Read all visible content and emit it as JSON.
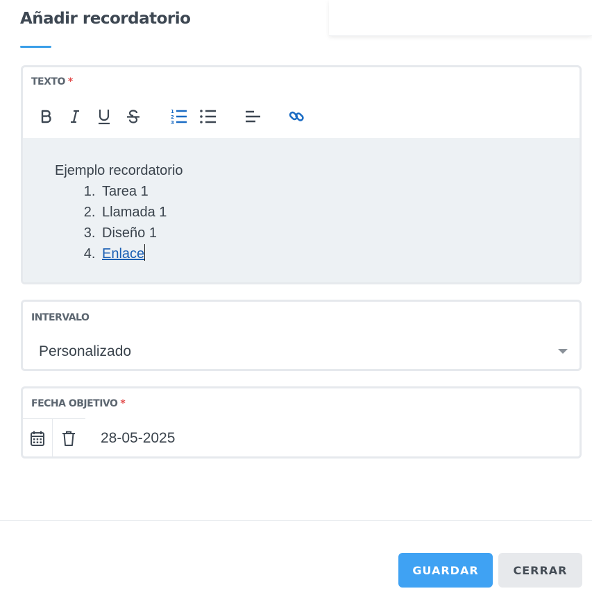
{
  "dialog": {
    "title": "Añadir recordatorio"
  },
  "texto_field": {
    "label": "TEXTO",
    "required_mark": "*",
    "toolbar": {
      "bold": "bold-icon",
      "italic": "italic-icon",
      "underline": "underline-icon",
      "strikethrough": "strikethrough-icon",
      "ordered_list": "ordered-list-icon",
      "bullet_list": "bullet-list-icon",
      "align": "align-left-icon",
      "link": "link-icon"
    },
    "content": {
      "intro": "Ejemplo recordatorio",
      "items": [
        "Tarea 1",
        "Llamada 1",
        "Diseño 1",
        "Enlace"
      ]
    },
    "active_color": "#1a6cc4"
  },
  "intervalo_field": {
    "label": "INTERVALO",
    "selected_value": "Personalizado"
  },
  "fecha_field": {
    "label": "FECHA OBJETIVO",
    "required_mark": "*",
    "value": "28-05-2025"
  },
  "actions": {
    "save_label": "GUARDAR",
    "close_label": "CERRAR"
  },
  "colors": {
    "accent": "#3fa2f3",
    "required": "#e24b4b"
  }
}
